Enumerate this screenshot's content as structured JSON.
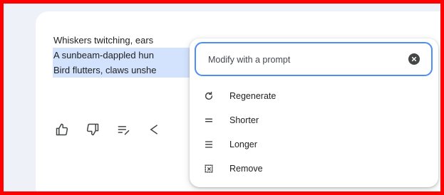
{
  "response": {
    "lines": [
      "Whiskers twitching, ears",
      "A sunbeam-dappled hun",
      "Bird flutters, claws unshe"
    ]
  },
  "toolbar": {
    "icons": [
      "thumbs-up-icon",
      "thumbs-down-icon",
      "modify-response-icon",
      "share-icon"
    ]
  },
  "modify_menu": {
    "prompt_placeholder": "Modify with a prompt",
    "items": [
      {
        "label": "Regenerate",
        "icon": "regenerate-icon"
      },
      {
        "label": "Shorter",
        "icon": "shorter-icon"
      },
      {
        "label": "Longer",
        "icon": "longer-icon"
      },
      {
        "label": "Remove",
        "icon": "remove-icon"
      }
    ]
  },
  "colors": {
    "frame_border": "#ff0000",
    "page_background": "#eef1f8",
    "highlight": "#d3e3fd",
    "focus_ring": "#4c8df6",
    "text": "#1f1f1f",
    "icon": "#444746"
  }
}
